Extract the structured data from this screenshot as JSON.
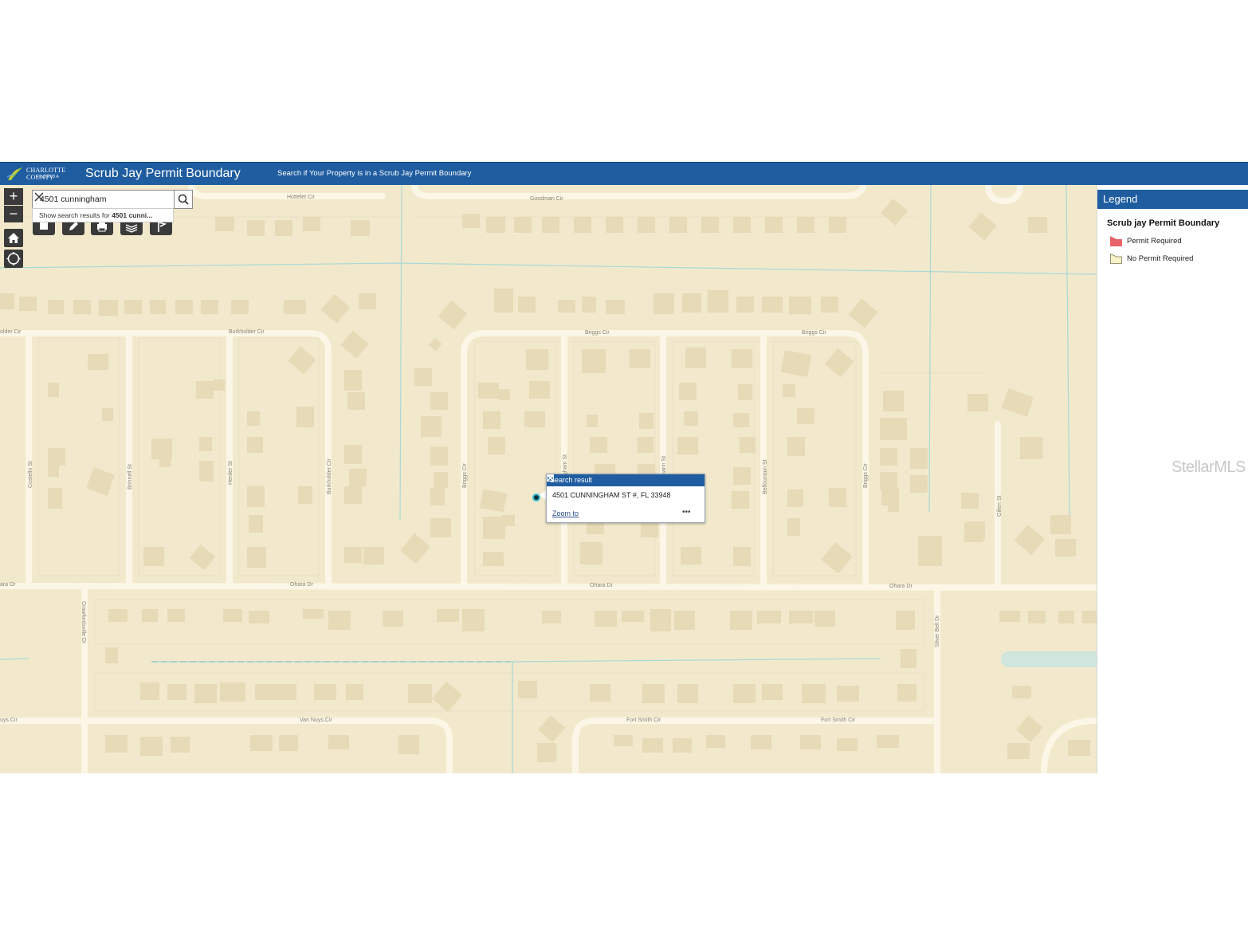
{
  "header": {
    "logo_name": "CHARLOTTE COUNTY",
    "logo_sub": "FLORIDA",
    "title": "Scrub Jay Permit Boundary",
    "subtitle": "Search if Your Property is in a Scrub Jay Permit Boundary",
    "color": "#1f5da0"
  },
  "map_controls": {
    "zoom_in": "+",
    "zoom_out": "−",
    "home_icon": "home-icon",
    "locate_icon": "locate-icon"
  },
  "search": {
    "value": "4501 cunningham",
    "suggestion_prefix": "Show search results for ",
    "suggestion_term": "4501 cunni..."
  },
  "toolbar": [
    "basemap-icon",
    "draw-icon",
    "print-icon",
    "layers-icon",
    "measure-icon"
  ],
  "popup": {
    "title": "Search result",
    "address": "4501 CUNNINGHAM ST #, FL 33948",
    "zoom_link": "Zoom to",
    "more": "•••"
  },
  "legend": {
    "title": "Legend",
    "layer": "Scrub jay Permit Boundary",
    "items": [
      {
        "label": "Permit Required",
        "color": "#e8646a"
      },
      {
        "label": "No Permit Required",
        "color": "#f7f3c6"
      }
    ]
  },
  "streets": {
    "hottelet": "Hottelet Cir",
    "goodman": "Goodman Cir",
    "burkholder_cir_left": "older Cir",
    "burkholder_cir": "Burkholder Cir",
    "briggs_cir_1": "Briggs Cir",
    "briggs_cir_2": "Briggs Cir",
    "costello": "Costello St",
    "brinnell": "Brinnell St",
    "herder": "Herder St",
    "burkholder_v": "Burkholder Cir",
    "briggs_v": "Briggs Cir",
    "cunningham": "ngham St",
    "mann": "mann St",
    "belfountain": "Belfountain St",
    "briggs_v2": "Briggs Cir",
    "gillen": "Gillen St",
    "ohara_left": "ara Dr",
    "ohara_1": "Ohara Dr",
    "ohara_2": "Ohara Dr",
    "ohara_3": "Ohara Dr",
    "crawfordsville": "Crawfordsville Dr",
    "silver_bell": "Silver Bell Dr",
    "nuys_left": "uys Cir",
    "van_nuys": "Van Nuys Cir",
    "fort_smith_1": "Fort Smith Cir",
    "fort_smith_2": "Fort Smith Cir"
  },
  "watermark": "StellarMLS",
  "map_colors": {
    "land": "#f2e9cc",
    "road": "#fbf6e6",
    "building": "#e6dab7",
    "water": "#cfe5dd",
    "canal": "#a8d8d6"
  }
}
